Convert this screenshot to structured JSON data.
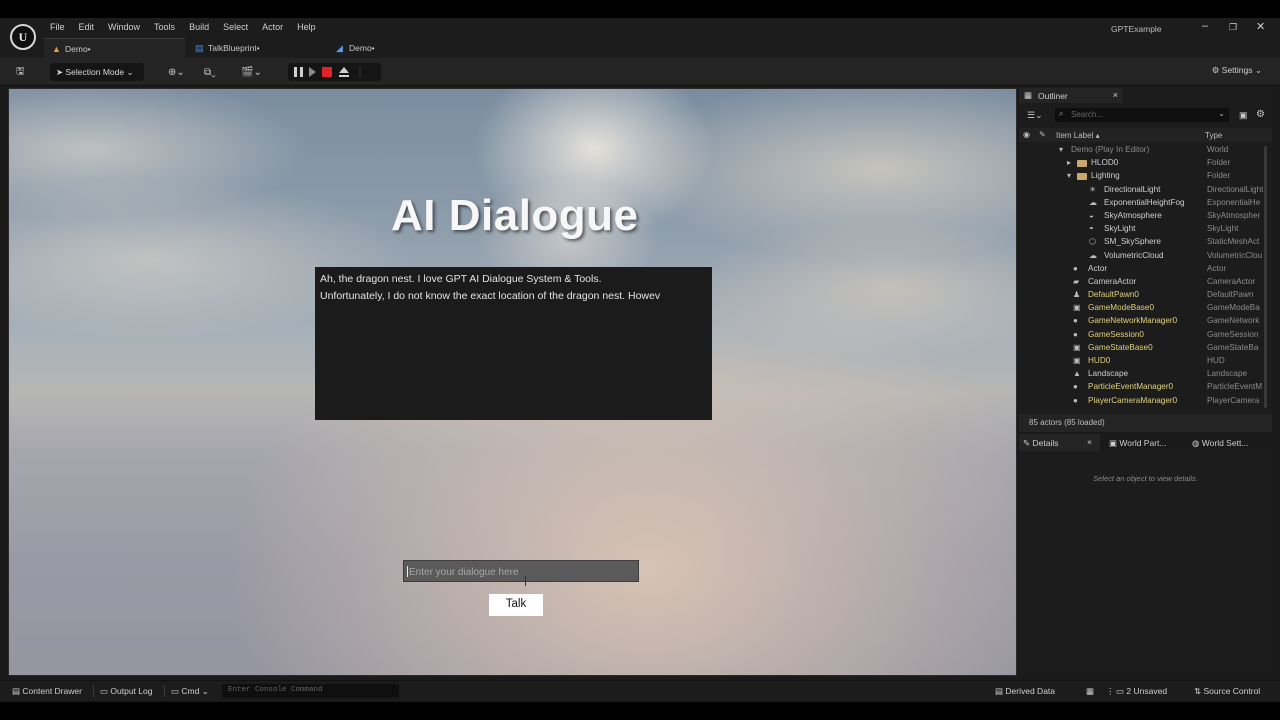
{
  "menu": [
    "File",
    "Edit",
    "Window",
    "Tools",
    "Build",
    "Select",
    "Actor",
    "Help"
  ],
  "app_title": "GPTExample",
  "window_controls": {
    "minimize": "–",
    "restore": "❐",
    "close": "✕"
  },
  "tabs": [
    {
      "label": "Demo•",
      "icon": "level-icon"
    },
    {
      "label": "TalkBlueprint•",
      "icon": "blueprint-icon"
    },
    {
      "label": "Demo•",
      "icon": "widget-icon"
    }
  ],
  "toolbar": {
    "mode": "Selection Mode",
    "settings": "Settings"
  },
  "viewport": {
    "title": "AI Dialogue",
    "dialogue_lines": [
      "Ah, the dragon nest. I love GPT AI Dialogue System & Tools.",
      "Unfortunately, I do not know the exact location of the dragon nest. Howev"
    ],
    "input_placeholder": "Enter your dialogue here",
    "talk_button": "Talk"
  },
  "outliner": {
    "tab_label": "Outliner",
    "search_placeholder": "Search...",
    "col_label": "Item Label ▴",
    "col_type": "Type",
    "rows": [
      {
        "label": "Demo (Play In Editor)",
        "type": "World",
        "indent": 0,
        "arrow": "▾",
        "icon": ""
      },
      {
        "label": "HLOD0",
        "type": "Folder",
        "indent": 1,
        "arrow": "▸",
        "icon": "folder"
      },
      {
        "label": "Lighting",
        "type": "Folder",
        "indent": 1,
        "arrow": "▾",
        "icon": "folder"
      },
      {
        "label": "DirectionalLight",
        "type": "DirectionalLight",
        "indent": 2,
        "arrow": "",
        "icon": "☀"
      },
      {
        "label": "ExponentialHeightFog",
        "type": "ExponentialHe",
        "indent": 2,
        "arrow": "",
        "icon": "☁"
      },
      {
        "label": "SkyAtmosphere",
        "type": "SkyAtmospher",
        "indent": 2,
        "arrow": "",
        "icon": "◒"
      },
      {
        "label": "SkyLight",
        "type": "SkyLight",
        "indent": 2,
        "arrow": "",
        "icon": "◓"
      },
      {
        "label": "SM_SkySphere",
        "type": "StaticMeshAct",
        "indent": 2,
        "arrow": "",
        "icon": "⬡"
      },
      {
        "label": "VolumetricCloud",
        "type": "VolumetricClou",
        "indent": 2,
        "arrow": "",
        "icon": "☁"
      },
      {
        "label": "Actor",
        "type": "Actor",
        "indent": 0,
        "arrow": "",
        "icon": "●"
      },
      {
        "label": "CameraActor",
        "type": "CameraActor",
        "indent": 0,
        "arrow": "",
        "icon": "▰"
      },
      {
        "label": "DefaultPawn0",
        "type": "DefaultPawn",
        "indent": 0,
        "arrow": "",
        "icon": "♟",
        "yellow": true
      },
      {
        "label": "GameModeBase0",
        "type": "GameModeBa",
        "indent": 0,
        "arrow": "",
        "icon": "▣",
        "yellow": true
      },
      {
        "label": "GameNetworkManager0",
        "type": "GameNetwork",
        "indent": 0,
        "arrow": "",
        "icon": "●",
        "yellow": true
      },
      {
        "label": "GameSession0",
        "type": "GameSession",
        "indent": 0,
        "arrow": "",
        "icon": "●",
        "yellow": true
      },
      {
        "label": "GameStateBase0",
        "type": "GameStateBa",
        "indent": 0,
        "arrow": "",
        "icon": "▣",
        "yellow": true
      },
      {
        "label": "HUD0",
        "type": "HUD",
        "indent": 0,
        "arrow": "",
        "icon": "▣",
        "yellow": true
      },
      {
        "label": "Landscape",
        "type": "Landscape",
        "indent": 0,
        "arrow": "",
        "icon": "▲"
      },
      {
        "label": "ParticleEventManager0",
        "type": "ParticleEventM",
        "indent": 0,
        "arrow": "",
        "icon": "●",
        "yellow": true
      },
      {
        "label": "PlayerCameraManager0",
        "type": "PlayerCamera",
        "indent": 0,
        "arrow": "",
        "icon": "●",
        "yellow": true
      }
    ],
    "footer": "85 actors (85 loaded)"
  },
  "details": {
    "tabs": [
      "Details",
      "World Part...",
      "World Sett..."
    ],
    "empty_text": "Select an object to view details."
  },
  "statusbar": {
    "content_drawer": "Content Drawer",
    "output_log": "Output Log",
    "cmd": "Cmd",
    "console_placeholder": "Enter Console Command",
    "derived_data": "Derived Data",
    "unsaved": "2 Unsaved",
    "source_control": "Source Control"
  },
  "colors": {
    "accent_yellow": "#e2d27a",
    "stop_red": "#e2232a",
    "folder": "#c9a86a"
  }
}
